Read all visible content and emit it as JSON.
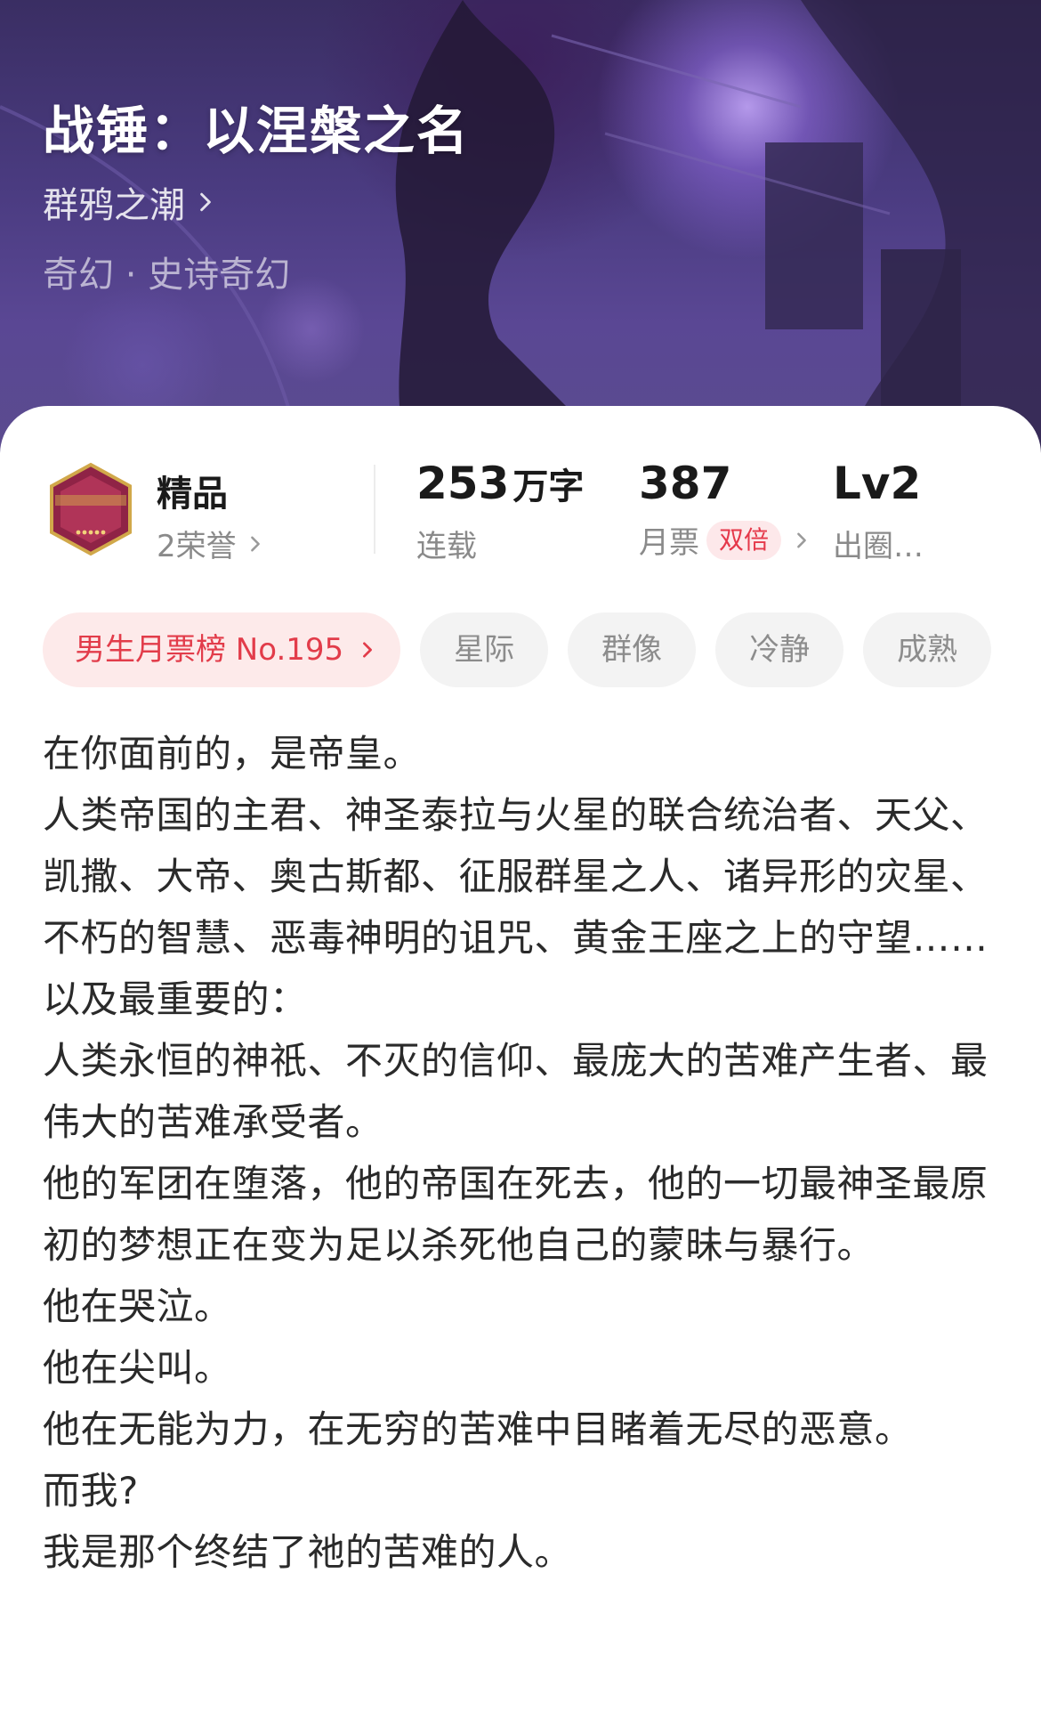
{
  "book": {
    "title": "战锤：以涅槃之名",
    "author": "群鸦之潮",
    "genre": "奇幻 · 史诗奇幻"
  },
  "stats": {
    "quality": {
      "label": "精品",
      "honor": "2荣誉",
      "badge_icon": "jingpin-channel-badge-icon"
    },
    "words": {
      "value": "253",
      "unit": "万字",
      "status": "连载"
    },
    "monthly_votes": {
      "value": "387",
      "label": "月票",
      "tag": "双倍"
    },
    "level": {
      "value": "Lv2",
      "label": "出圈…"
    }
  },
  "tags": {
    "rank": "男生月票榜 No.195",
    "items": [
      "星际",
      "群像",
      "冷静",
      "成熟"
    ]
  },
  "description": {
    "lines": [
      "在你面前的，是帝皇。",
      "人类帝国的主君、神圣泰拉与火星的联合统治者、天父、凯撒、大帝、奥古斯都、征服群星之人、诸异形的灾星、不朽的智慧、恶毒神明的诅咒、黄金王座之上的守望……",
      "以及最重要的：",
      "人类永恒的神祇、不灭的信仰、最庞大的苦难产生者、最伟大的苦难承受者。",
      "他的军团在堕落，他的帝国在死去，他的一切最神圣最原初的梦想正在变为足以杀死他自己的蒙昧与暴行。",
      "他在哭泣。",
      "他在尖叫。",
      "他在无能为力，在无穷的苦难中目睹着无尽的恶意。",
      "而我?",
      "我是那个终结了祂的苦难的人。"
    ]
  },
  "colors": {
    "accent_red": "#e23c4a",
    "hero_purple": "#4a3b80"
  }
}
